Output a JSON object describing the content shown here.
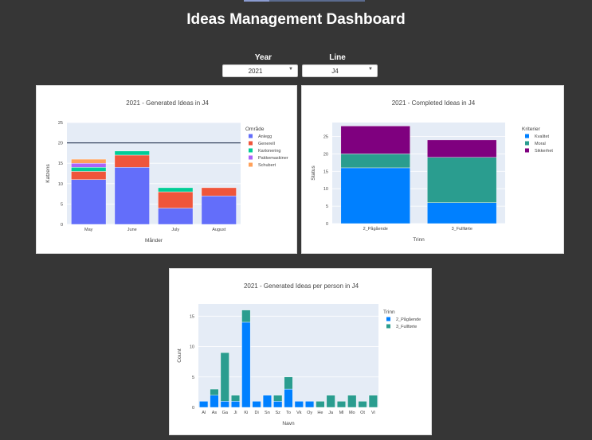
{
  "header": {
    "title": "Ideas Management Dashboard"
  },
  "filters": {
    "year": {
      "label": "Year",
      "value": "2021"
    },
    "line": {
      "label": "Line",
      "value": "J4"
    }
  },
  "colors": {
    "page_bg": "#363636",
    "plot_bg": "#E5ECF6",
    "blue": "#636EFA",
    "red": "#EF553B",
    "green": "#00CC96",
    "purple": "#AB63FA",
    "orange": "#FFA15A",
    "strong_blue": "#0080FF",
    "teal": "#2A9D8F",
    "dark_purple": "#7F007F"
  },
  "chart_data": [
    {
      "type": "bar",
      "stacked": true,
      "title": "2021 - Generated Ideas in J4",
      "xlabel": "Månder",
      "ylabel": "Katzens",
      "ylim": [
        0,
        25
      ],
      "yticks": [
        0,
        5,
        10,
        15,
        20,
        25
      ],
      "categories": [
        "May",
        "June",
        "July",
        "August"
      ],
      "legend_title": "Område",
      "legend_position": "right",
      "reference_line": 20,
      "series": [
        {
          "name": "Anlegg",
          "color": "#636EFA",
          "values": [
            11,
            14,
            4,
            7
          ]
        },
        {
          "name": "Generell",
          "color": "#EF553B",
          "values": [
            2,
            3,
            4,
            2
          ]
        },
        {
          "name": "Kartonering",
          "color": "#00CC96",
          "values": [
            1,
            1,
            1,
            0
          ]
        },
        {
          "name": "Pakkemaskiner",
          "color": "#AB63FA",
          "values": [
            1,
            0,
            0,
            0
          ]
        },
        {
          "name": "Schubert",
          "color": "#FFA15A",
          "values": [
            1,
            0,
            0,
            0
          ]
        }
      ]
    },
    {
      "type": "bar",
      "stacked": true,
      "title": "2021 - Completed Ideas in J4",
      "xlabel": "Trinn",
      "ylabel": "Status",
      "ylim": [
        0,
        29
      ],
      "yticks": [
        0,
        5,
        10,
        15,
        20,
        25
      ],
      "categories": [
        "2_Pågående",
        "3_Fullførte"
      ],
      "legend_title": "Kriterier",
      "legend_position": "right",
      "series": [
        {
          "name": "Kvalitet",
          "color": "#0080FF",
          "values": [
            16,
            6
          ]
        },
        {
          "name": "Moral",
          "color": "#2A9D8F",
          "values": [
            4,
            13
          ]
        },
        {
          "name": "Sikkerhet",
          "color": "#7F007F",
          "values": [
            8,
            5
          ]
        }
      ]
    },
    {
      "type": "bar",
      "stacked": true,
      "title": "2021 - Generated Ideas per person in J4",
      "xlabel": "Navn",
      "ylabel": "Count",
      "ylim": [
        0,
        17
      ],
      "yticks": [
        0,
        5,
        10,
        15
      ],
      "categories": [
        "Al",
        "As",
        "Ga",
        "Ji",
        "Ki",
        "Di",
        "Sn",
        "Sz",
        "To",
        "Vk",
        "Oy",
        "He",
        "Ja",
        "Ml",
        "Mo",
        "Ot",
        "Vi"
      ],
      "legend_title": "Trinn",
      "legend_position": "right",
      "series": [
        {
          "name": "2_Pågående",
          "color": "#0080FF",
          "values": [
            1,
            2,
            1,
            1,
            14,
            1,
            2,
            1,
            3,
            1,
            1,
            0,
            0,
            0,
            0,
            0,
            0
          ]
        },
        {
          "name": "3_Fullførte",
          "color": "#2A9D8F",
          "values": [
            0,
            1,
            8,
            1,
            2,
            0,
            0,
            1,
            2,
            0,
            0,
            1,
            2,
            1,
            2,
            1,
            2
          ]
        }
      ]
    }
  ]
}
